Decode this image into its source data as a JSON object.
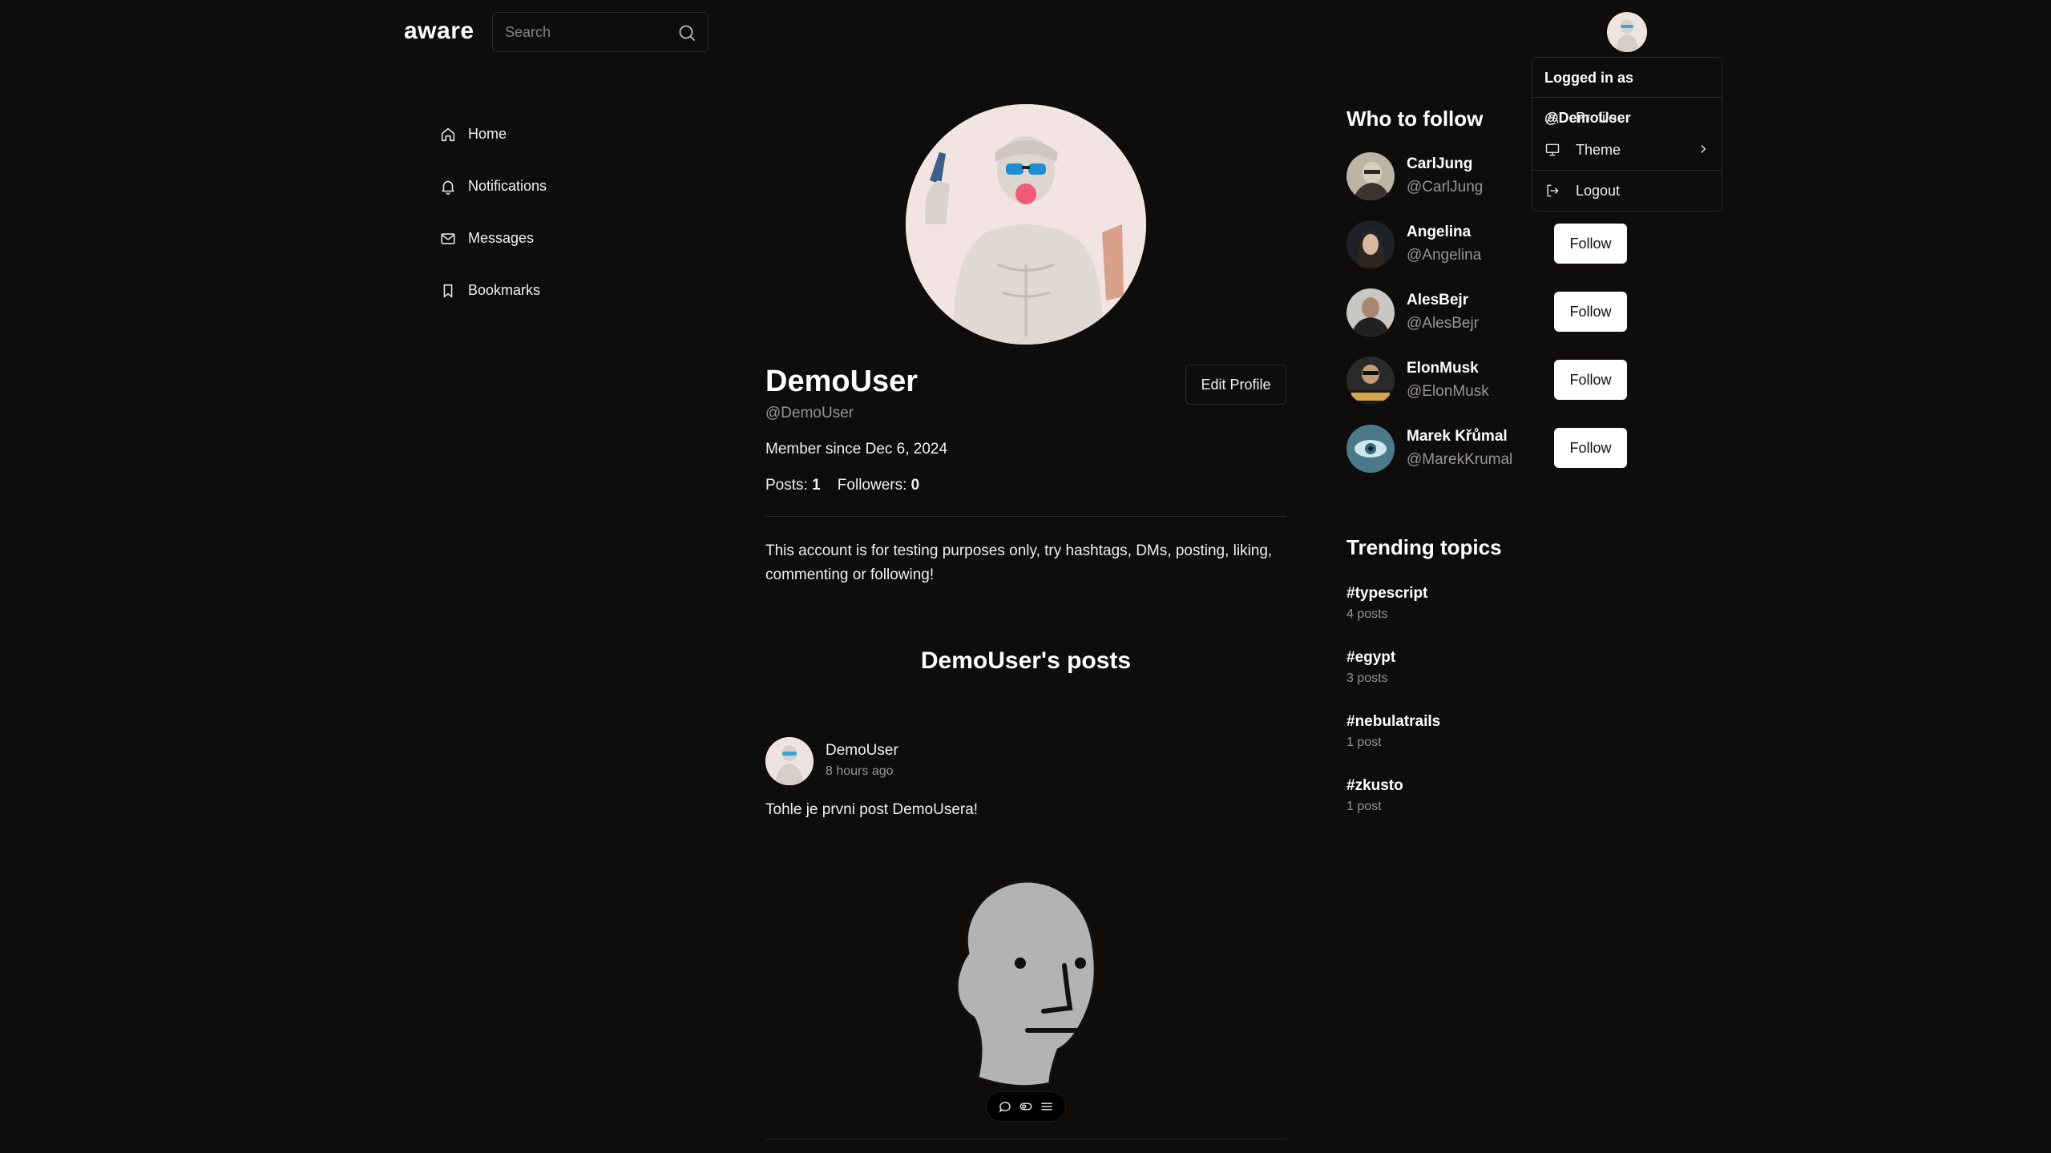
{
  "header": {
    "logo": "aware",
    "search_placeholder": "Search"
  },
  "sidebar": {
    "items": [
      {
        "label": "Home",
        "icon": "home-icon"
      },
      {
        "label": "Notifications",
        "icon": "bell-icon"
      },
      {
        "label": "Messages",
        "icon": "mail-icon"
      },
      {
        "label": "Bookmarks",
        "icon": "bookmark-icon"
      }
    ]
  },
  "profile": {
    "name": "DemoUser",
    "handle": "@DemoUser",
    "edit_label": "Edit Profile",
    "member_since": "Member since Dec 6, 2024",
    "posts_label": "Posts:",
    "posts_count": "1",
    "followers_label": "Followers:",
    "followers_count": "0",
    "bio": "This account is for testing purposes only, try hashtags, DMs, posting, liking, commenting or following!",
    "posts_heading": "DemoUser's posts"
  },
  "post": {
    "author": "DemoUser",
    "time": "8 hours ago",
    "text": "Tohle je prvni post DemoUsera!",
    "actions": [
      "comment-icon",
      "like-toggle-icon",
      "more-icon"
    ]
  },
  "who_to_follow": {
    "title": "Who to follow",
    "follow_label": "Follow",
    "users": [
      {
        "name": "CarlJung",
        "handle": "@CarlJung"
      },
      {
        "name": "Angelina",
        "handle": "@Angelina"
      },
      {
        "name": "AlesBejr",
        "handle": "@AlesBejr"
      },
      {
        "name": "ElonMusk",
        "handle": "@ElonMusk"
      },
      {
        "name": "Marek Křůmal",
        "handle": "@MarekKrumal"
      }
    ]
  },
  "trending": {
    "title": "Trending topics",
    "topics": [
      {
        "tag": "#typescript",
        "count": "4 posts"
      },
      {
        "tag": "#egypt",
        "count": "3 posts"
      },
      {
        "tag": "#nebulatrails",
        "count": "1 post"
      },
      {
        "tag": "#zkusto",
        "count": "1 post"
      }
    ]
  },
  "user_menu": {
    "header": "Logged in as @DemoUser",
    "items": [
      {
        "label": "Profile",
        "icon": "user-icon"
      },
      {
        "label": "Theme",
        "icon": "monitor-icon"
      },
      {
        "label": "Logout",
        "icon": "logout-icon"
      }
    ]
  },
  "colors": {
    "background": "#0f0c0c",
    "text": "#f2f2f2",
    "muted": "#9a9494",
    "border": "#2c2828",
    "button_bg": "#ffffff"
  }
}
